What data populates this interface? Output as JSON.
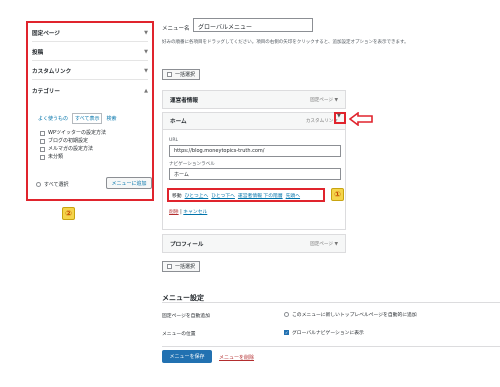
{
  "colors": {
    "highlight": "#e0242d",
    "link": "#0073aa",
    "badge": "#f5d54b",
    "primary": "#2271b1",
    "delete": "#b32d2e"
  },
  "left_panel": {
    "sections": [
      {
        "label": "固定ページ"
      },
      {
        "label": "投稿"
      },
      {
        "label": "カスタムリンク"
      },
      {
        "label": "カテゴリー"
      }
    ],
    "tabs": {
      "recent": "よく使うもの",
      "all": "すべて表示",
      "search": "検索"
    },
    "categories": [
      "WPツイッターの設定方法",
      "ブログの初期設定",
      "メルマガの設定方法",
      "未分類"
    ],
    "select_all": "すべて選択",
    "add_to_menu": "メニューに追加",
    "badge": "②"
  },
  "menu": {
    "name_label": "メニュー名",
    "name_value": "グローバルメニュー",
    "description": "好みの順番に各項目をドラッグしてください。項目の右側の矢印をクリックすると、追加設定オプションを表示できます。",
    "bulk_select": "一括選択",
    "items": [
      {
        "title": "運営者情報",
        "type": "固定ページ"
      },
      {
        "title": "ホーム",
        "type": "カスタムリンク"
      },
      {
        "title": "プロフィール",
        "type": "固定ページ"
      }
    ],
    "url_label": "URL",
    "url_value": "https://blog.moneytopics-truth.com/",
    "nav_label": "ナビゲーションラベル",
    "nav_value": "ホーム",
    "move_label": "移動",
    "move_links": [
      "ひとつ上へ",
      "ひとつ下へ",
      "運営者情報 下の階層",
      "先頭へ"
    ],
    "badge": "①",
    "delete": "削除",
    "separator": "|",
    "cancel": "キャンセル"
  },
  "settings": {
    "title": "メニュー設定",
    "auto_add_label": "固定ページを自動追加",
    "auto_add_option": "このメニューに新しいトップレベルページを自動的に追加",
    "location_label": "メニューの位置",
    "location_option": "グローバルナビゲーションに表示"
  },
  "footer": {
    "save": "メニューを保存",
    "delete_menu": "メニューを削除"
  }
}
